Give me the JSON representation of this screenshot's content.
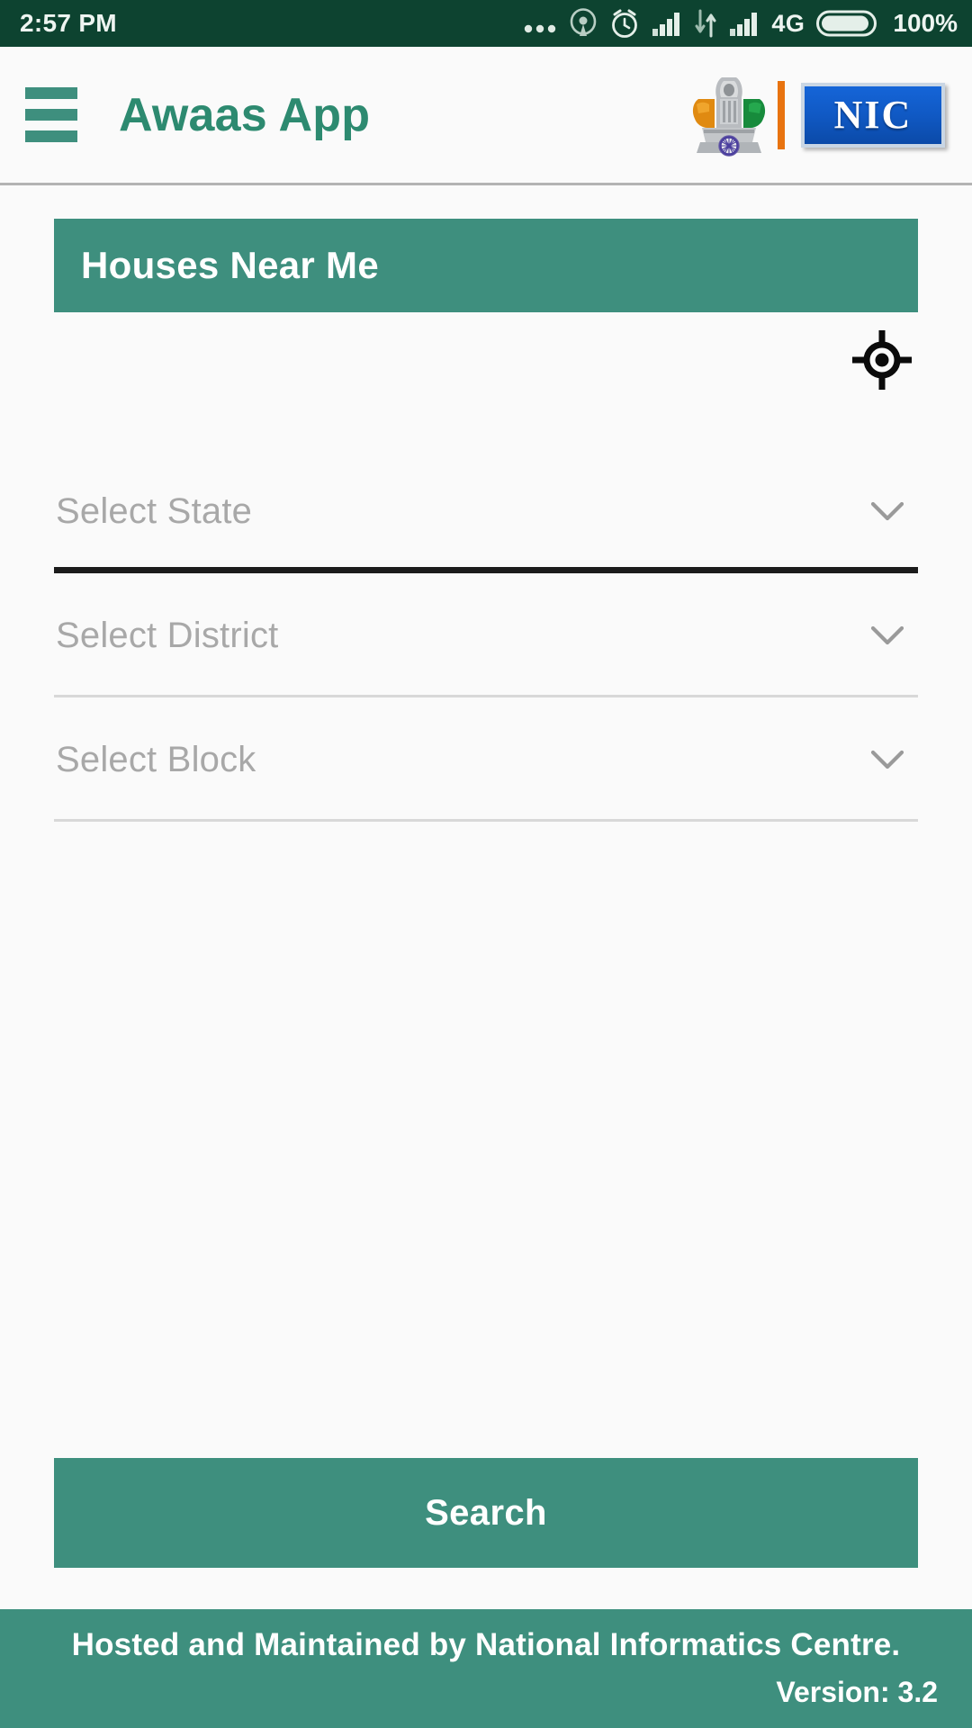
{
  "status_bar": {
    "time": "2:57 PM",
    "network_type": "4G",
    "battery_percent": "100%",
    "icons": [
      "more-dots-icon",
      "cast-icon",
      "alarm-clock-icon",
      "signal-bars-icon",
      "data-transfer-icon",
      "signal-bars-icon",
      "battery-icon"
    ],
    "background_color": "#0d4330",
    "foreground_color": "#eef5f1"
  },
  "app_bar": {
    "menu_icon": "hamburger-menu-icon",
    "title": "Awaas App",
    "title_color": "#2d8a70",
    "emblem_icon": "india-national-emblem-icon",
    "nic_logo_text": "NIC",
    "nic_logo_color": "#1059c4",
    "divider_color": "#e8730f"
  },
  "main": {
    "banner_title": "Houses Near Me",
    "banner_color": "#3e8f7e",
    "locate_icon": "my-location-crosshair-icon",
    "fields": [
      {
        "name": "state",
        "placeholder": "Select State",
        "value": "",
        "active": true,
        "chevron": "chevron-down-icon"
      },
      {
        "name": "district",
        "placeholder": "Select District",
        "value": "",
        "active": false,
        "chevron": "chevron-down-icon"
      },
      {
        "name": "block",
        "placeholder": "Select Block",
        "value": "",
        "active": false,
        "chevron": "chevron-down-icon"
      }
    ],
    "search_label": "Search"
  },
  "footer": {
    "hosted_text": "Hosted and Maintained by National Informatics Centre.",
    "version_text": "Version: 3.2",
    "background_color": "#3e8f7e"
  }
}
